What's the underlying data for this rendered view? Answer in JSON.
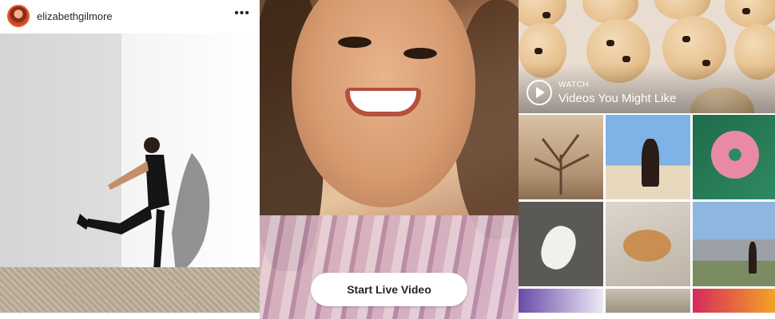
{
  "post": {
    "username": "elizabethgilmore",
    "more_icon": "more-horizontal-icon",
    "more_glyph": "•••"
  },
  "live": {
    "button_label": "Start Live Video"
  },
  "explore": {
    "watch_label": "WATCH",
    "videos_title": "Videos You Might Like",
    "play_icon": "play-icon",
    "tiles": 9
  }
}
